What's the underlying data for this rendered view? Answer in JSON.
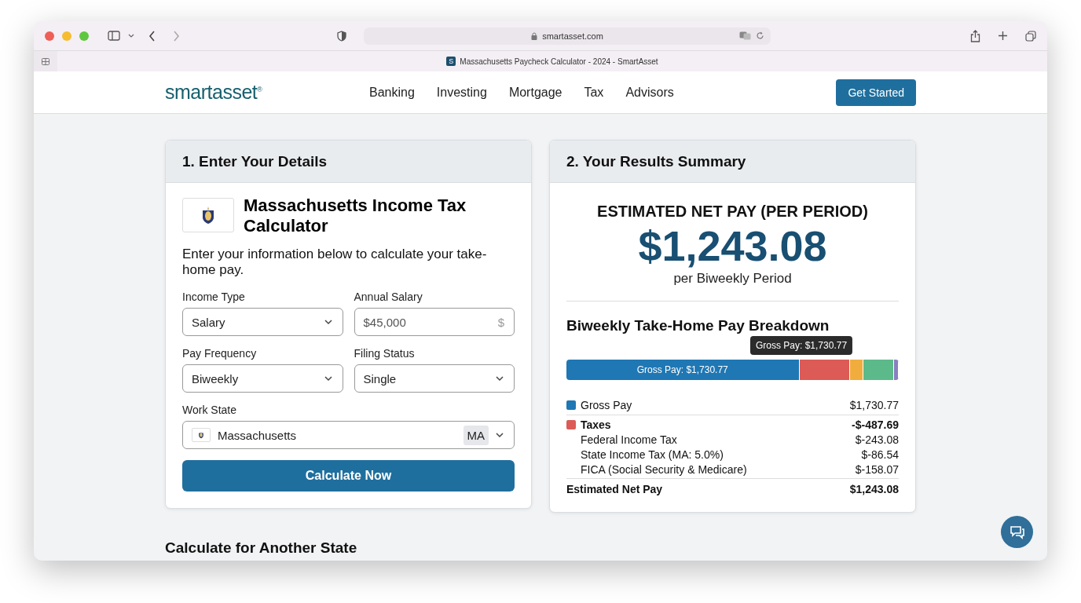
{
  "browser": {
    "url": "smartasset.com",
    "tab": {
      "favicon": "S",
      "title": "Massachusetts Paycheck Calculator - 2024 - SmartAsset"
    }
  },
  "site_nav": {
    "logo": "smartasset$^{®}$",
    "links": [
      "Banking",
      "Investing",
      "Mortgage",
      "Tax",
      "Advisors"
    ],
    "cta": "Get Started"
  },
  "details_card": {
    "title": "1. Enter Your Details",
    "heading": "Massachusetts Income Tax Calculator",
    "intro": "Enter your information below to calculate your take-home pay.",
    "fields": [
      {
        "label": "Income Type",
        "value": "Salary",
        "kind": "select"
      },
      {
        "label": "Annual Salary",
        "value": "$45,000",
        "suffix": "$",
        "kind": "input"
      },
      {
        "label": "Pay Frequency",
        "value": "Biweekly",
        "kind": "select"
      },
      {
        "label": "Filing Status",
        "value": "Single",
        "kind": "select"
      }
    ],
    "work_state": {
      "label": "Work State",
      "value": "Massachusetts",
      "code": "MA"
    },
    "button": "Calculate Now"
  },
  "results_card": {
    "title": "2. Your Results Summary",
    "net_label": "ESTIMATED NET PAY (PER PERIOD)",
    "net_amount": "$1,243.08",
    "period": "per Biweekly Period",
    "breakdown_title": "Biweekly Take-Home Pay Breakdown",
    "tooltip": "Gross Pay: $1,730.77",
    "segments": [
      {
        "color": "#1f77b4",
        "label": "Gross Pay: $1,730.77"
      },
      {
        "color": "#dc5b57"
      },
      {
        "color": "#f0ad3e"
      },
      {
        "color": "#5cb98a"
      },
      {
        "color": "#8a7fbf"
      }
    ],
    "rows": [
      {
        "kind": "item",
        "label": "Gross Pay",
        "amount": "$1,730.77",
        "color": "#1f77b4"
      },
      {
        "kind": "group",
        "label": "Taxes",
        "amount": "-$-487.69",
        "color": "#dc5b57"
      },
      {
        "kind": "sub",
        "label": "Federal Income Tax",
        "amount": "$-243.08"
      },
      {
        "kind": "sub",
        "label": "State Income Tax (MA: 5.0%)",
        "amount": "$-86.54"
      },
      {
        "kind": "sub",
        "label": "FICA (Social Security & Medicare)",
        "amount": "$-158.07"
      },
      {
        "kind": "total",
        "label": "Estimated Net Pay",
        "amount": "$1,243.08"
      }
    ]
  },
  "another_state": {
    "title": "Calculate for Another State"
  }
}
